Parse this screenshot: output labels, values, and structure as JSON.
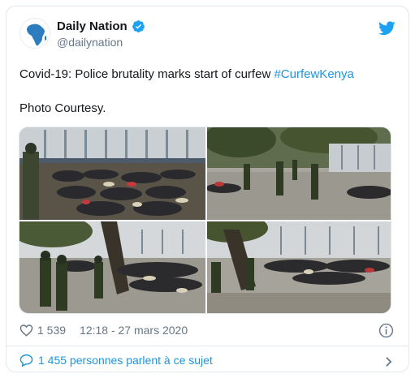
{
  "author": {
    "name": "Daily Nation",
    "handle": "@dailynation"
  },
  "tweet": {
    "text_prefix": "Covid-19: Police brutality marks start of curfew ",
    "hashtag": "#CurfewKenya",
    "text_line2": "Photo Courtesy."
  },
  "photos": [
    {
      "name": "photo-crowd-seated-by-wall"
    },
    {
      "name": "photo-police-on-street"
    },
    {
      "name": "photo-police-and-crowd-under-tree"
    },
    {
      "name": "photo-crowd-on-ground-tree"
    }
  ],
  "meta": {
    "likes": "1 539",
    "timestamp": "12:18 - 27 mars 2020"
  },
  "conversation": {
    "label": "1 455 personnes parlent à ce sujet"
  },
  "colors": {
    "accent": "#1b95e0",
    "muted": "#657786",
    "verified": "#1da1f2"
  },
  "icons": [
    "twitter-logo-icon",
    "verified-badge-icon",
    "heart-icon",
    "info-icon",
    "speech-bubble-icon",
    "chevron-right-icon"
  ]
}
